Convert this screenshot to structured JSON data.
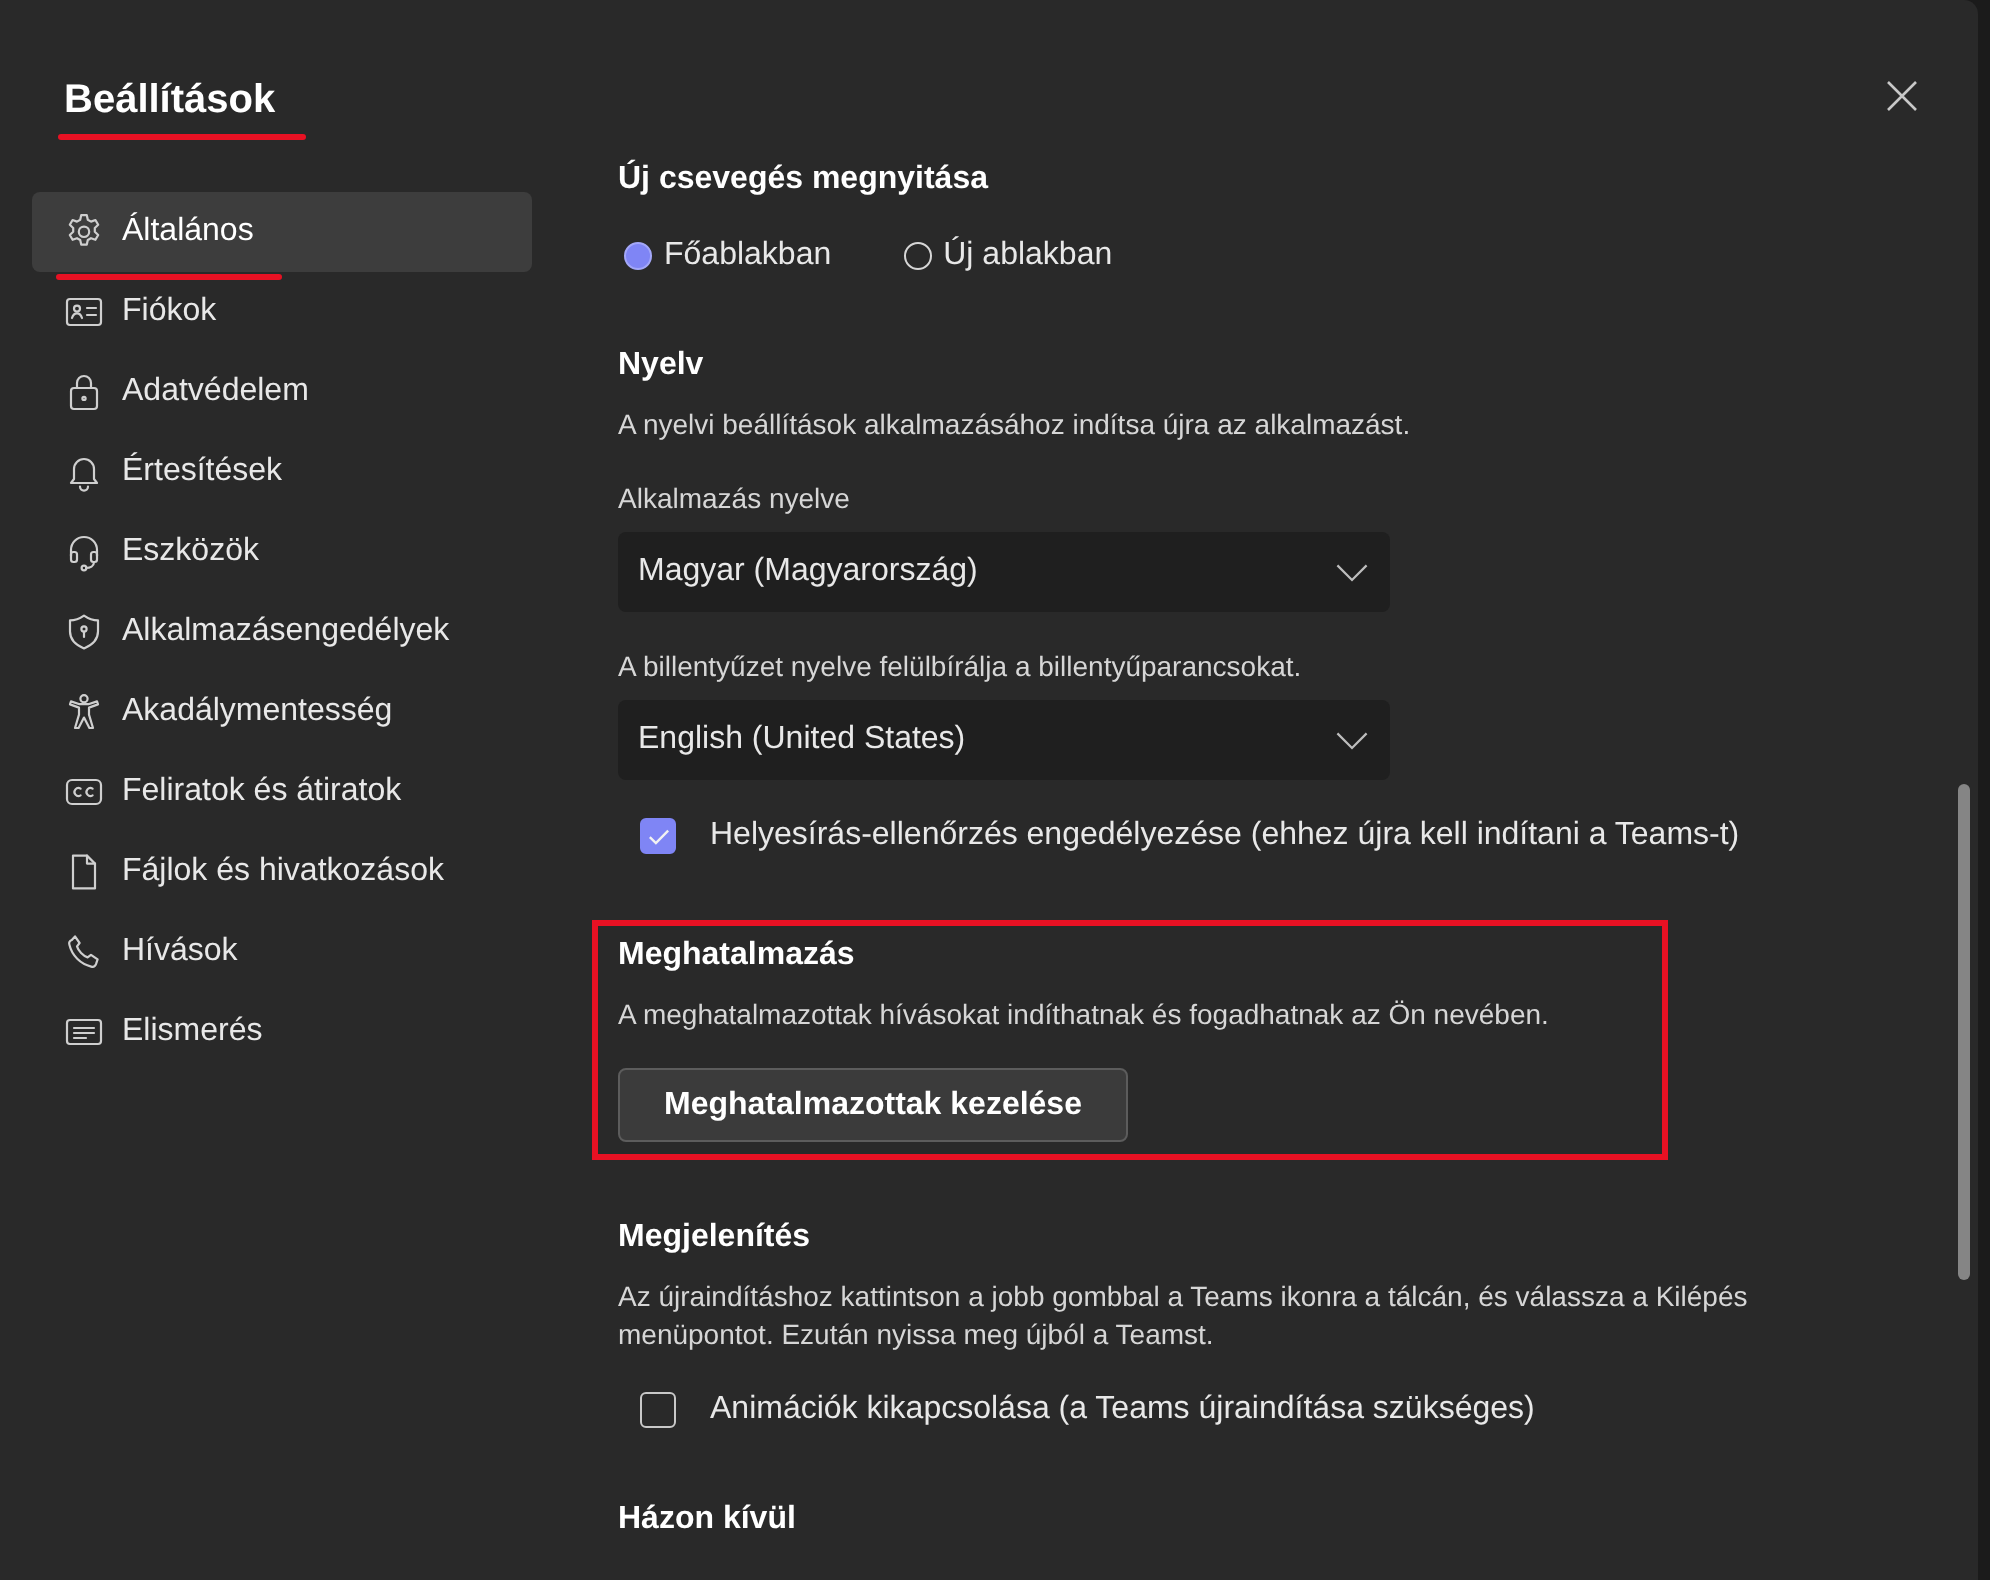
{
  "dialog": {
    "title": "Beállítások",
    "title_highlighted": true
  },
  "sidebar": {
    "items": [
      {
        "label": "Általános",
        "selected": true,
        "highlighted": true
      },
      {
        "label": "Fiókok",
        "selected": false,
        "highlighted": false
      },
      {
        "label": "Adatvédelem",
        "selected": false,
        "highlighted": false
      },
      {
        "label": "Értesítések",
        "selected": false,
        "highlighted": false
      },
      {
        "label": "Eszközök",
        "selected": false,
        "highlighted": false
      },
      {
        "label": "Alkalmazásengedélyek",
        "selected": false,
        "highlighted": false
      },
      {
        "label": "Akadálymentesség",
        "selected": false,
        "highlighted": false
      },
      {
        "label": "Feliratok és átiratok",
        "selected": false,
        "highlighted": false
      },
      {
        "label": "Fájlok és hivatkozások",
        "selected": false,
        "highlighted": false
      },
      {
        "label": "Hívások",
        "selected": false,
        "highlighted": false
      },
      {
        "label": "Elismerés",
        "selected": false,
        "highlighted": false
      }
    ]
  },
  "content": {
    "sections": [
      {
        "heading": "Új csevegés megnyitása",
        "highlighted": false,
        "items": [
          {
            "kind": "radio_group",
            "options": [
              {
                "label": "Főablakban",
                "selected": true
              },
              {
                "label": "Új ablakban",
                "selected": false
              }
            ]
          }
        ]
      },
      {
        "heading": "Nyelv",
        "highlighted": false,
        "items": [
          {
            "kind": "description",
            "text": "A nyelvi beállítások alkalmazásához indítsa újra az alkalmazást."
          },
          {
            "kind": "field_label",
            "text": "Alkalmazás nyelve"
          },
          {
            "kind": "dropdown",
            "value": "Magyar (Magyarország)"
          },
          {
            "kind": "field_label",
            "text": "A billentyűzet nyelve felülbírálja a billentyűparancsokat."
          },
          {
            "kind": "dropdown",
            "value": "English (United States)"
          },
          {
            "kind": "checkbox",
            "label": "Helyesírás-ellenőrzés engedélyezése (ehhez újra kell indítani a Teams-t)",
            "checked": true
          }
        ]
      },
      {
        "heading": "Meghatalmazás",
        "highlighted": true,
        "items": [
          {
            "kind": "description",
            "text": "A meghatalmazottak hívásokat indíthatnak és fogadhatnak az Ön nevében."
          },
          {
            "kind": "button",
            "label": "Meghatalmazottak kezelése"
          }
        ]
      },
      {
        "heading": "Megjelenítés",
        "highlighted": false,
        "items": [
          {
            "kind": "description",
            "text": "Az újraindításhoz kattintson a jobb gombbal a Teams ikonra a tálcán, és válassza a Kilépés menüpontot. Ezután nyissa meg újból a Teamst."
          },
          {
            "kind": "checkbox",
            "label": "Animációk kikapcsolása (a Teams újraindítása szükséges)",
            "checked": false
          }
        ]
      },
      {
        "heading": "Házon kívül",
        "highlighted": false
      }
    ]
  }
}
